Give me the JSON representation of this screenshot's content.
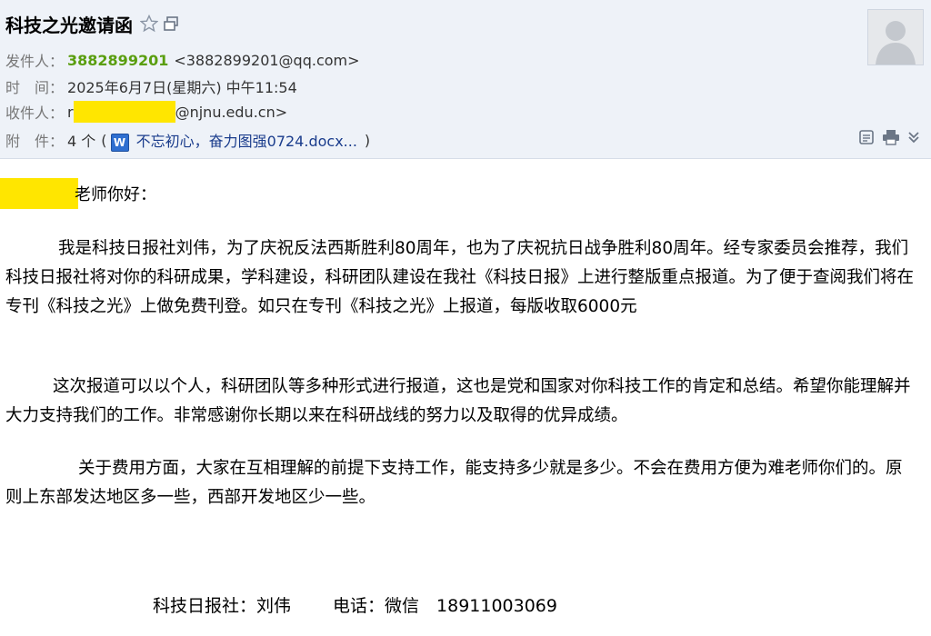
{
  "email": {
    "subject": "科技之光邀请函",
    "sender_label": "发件人：",
    "sender_name": "3882899201",
    "sender_email": "<3882899201@qq.com>",
    "time_label": "时　间：",
    "time_value": "2025年6月7日(星期六) 中午11:54",
    "recipient_label": "收件人：",
    "recipient_prefix": "r",
    "recipient_suffix": "@njnu.edu.cn>",
    "attachment_label": "附　件：",
    "attachment_count": "4 个",
    "attachment_open": "(",
    "attachment_name": "不忘初心，奋力图强0724.docx...",
    "attachment_close": ")",
    "docx_icon_letter": "W"
  },
  "body": {
    "greeting_suffix": "老师你好：",
    "paragraph1": "我是科技日报社刘伟，为了庆祝反法西斯胜利80周年，也为了庆祝抗日战争胜利80周年。经专家委员会推荐，我们科技日报社将对你的科研成果，学科建设，科研团队建设在我社《科技日报》上进行整版重点报道。为了便于查阅我们将在专刊《科技之光》上做免费刊登。如只在专刊《科技之光》上报道，每版收取6000元",
    "paragraph2": "这次报道可以以个人，科研团队等多种形式进行报道，这也是党和国家对你科技工作的肯定和总结。希望你能理解并大力支持我们的工作。非常感谢你长期以来在科研战线的努力以及取得的优异成绩。",
    "paragraph3": "关于费用方面，大家在互相理解的前提下支持工作，能支持多少就是多少。不会在费用方便为难老师你们的。原则上东部发达地区多一些，西部开发地区少一些。",
    "signature_org": "科技日报社：刘伟",
    "signature_phone": "电话：微信　18911003069"
  },
  "icons": {
    "star": "star-outline-icon",
    "window": "new-window-icon",
    "avatar": "user-silhouette-icon",
    "note": "note-icon",
    "print": "print-icon",
    "more": "double-chevron-down-icon"
  },
  "colors": {
    "header_bg": "#eef2f8",
    "sender_green": "#5a9e0f",
    "redaction_yellow": "#ffe600",
    "link_blue": "#1a3c8c"
  }
}
